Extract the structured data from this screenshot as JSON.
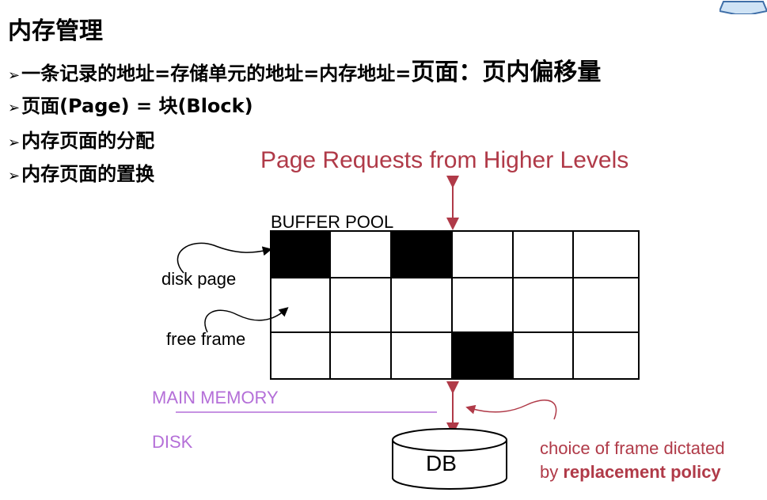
{
  "header": {
    "title": "内存管理"
  },
  "bullets": [
    {
      "marker": "➢",
      "text": "一条记录的地址=存储单元的地址=内存地址=",
      "emphasis": "页面：页内偏移量"
    },
    {
      "marker": "➢",
      "text": "页面(Page) = 块(Block)"
    },
    {
      "marker": "➢",
      "text": "内存页面的分配"
    },
    {
      "marker": "➢",
      "text": "内存页面的置换"
    }
  ],
  "diagram": {
    "request_label": "Page Requests from Higher Levels",
    "buffer_pool_label": "BUFFER POOL",
    "disk_page_label": "disk page",
    "free_frame_label": "free frame",
    "main_memory_label": "MAIN MEMORY",
    "disk_label": "DISK",
    "db_label": "DB",
    "choice_line1": "choice of frame dictated",
    "choice_line2_prefix": "by ",
    "choice_line2_bold": "replacement policy",
    "grid": {
      "rows": 3,
      "cols": 6,
      "filled_cells": [
        [
          0,
          0
        ],
        [
          0,
          2
        ],
        [
          2,
          3
        ]
      ]
    },
    "colors": {
      "request_text": "#b03a48",
      "memory_text": "#b46fd8",
      "arrow": "#b03a48",
      "divider": "#b46fd8"
    }
  }
}
